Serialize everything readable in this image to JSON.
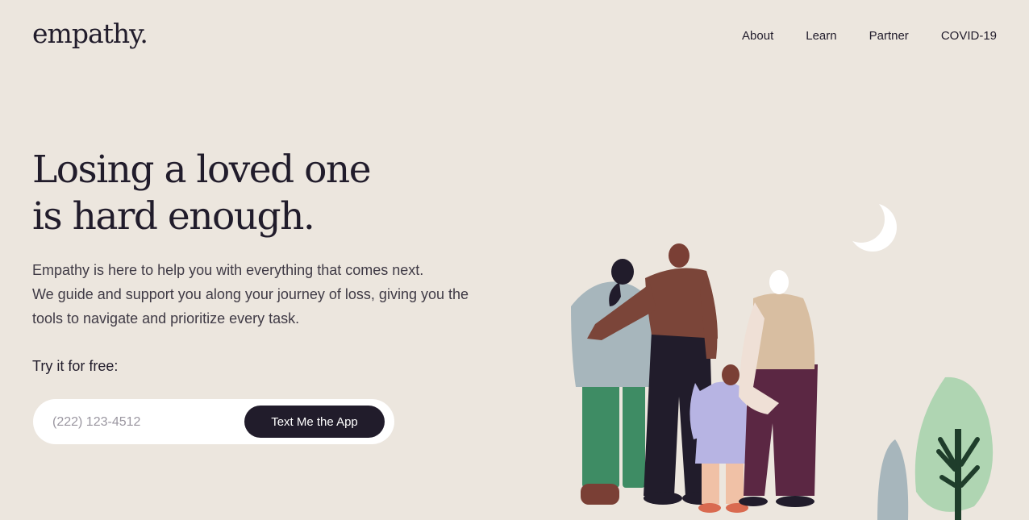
{
  "header": {
    "logo": "empathy.",
    "nav": [
      "About",
      "Learn",
      "Partner",
      "COVID-19"
    ]
  },
  "hero": {
    "headline_line1": "Losing a loved one",
    "headline_line2": "is hard enough.",
    "body_line1": "Empathy is here to help you with everything that comes next.",
    "body_line2": "We guide and support you along your journey of loss, giving you the",
    "body_line3": "tools to navigate and prioritize every task.",
    "try_label": "Try it for free:",
    "phone_placeholder": "(222) 123-4512",
    "cta_label": "Text Me the App"
  },
  "colors": {
    "background": "#ece6de",
    "text_dark": "#211c2b",
    "button_bg": "#211c2b",
    "button_text": "#ffffff",
    "input_bg": "#ffffff"
  },
  "icons": {
    "illustration": "family-group-illustration",
    "moon": "crescent-moon-icon",
    "tree": "tree-icon"
  }
}
